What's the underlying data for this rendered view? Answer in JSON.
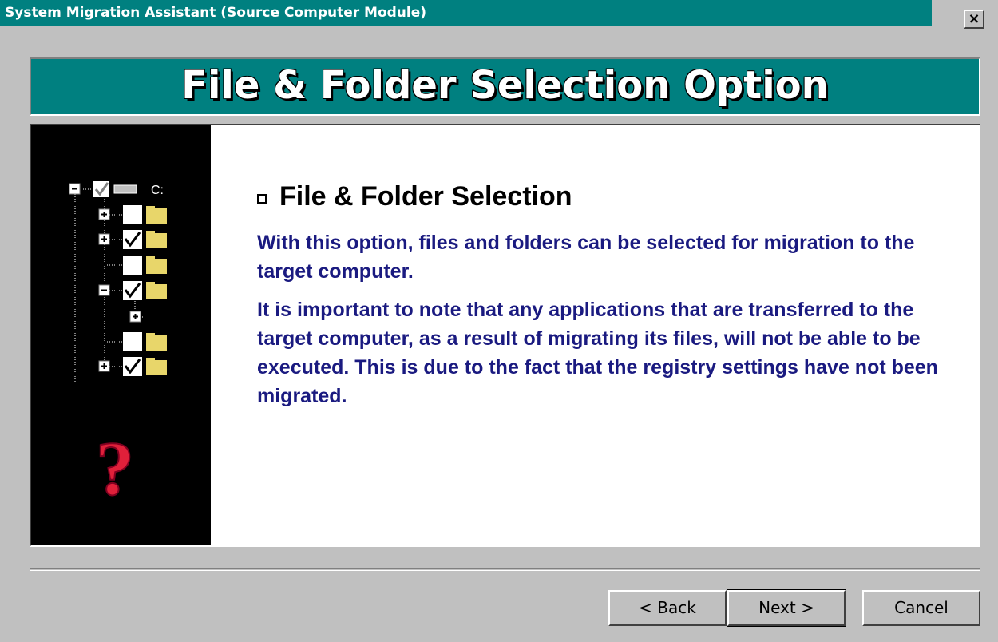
{
  "window": {
    "title": "System Migration Assistant (Source Computer Module)",
    "close_label": "×"
  },
  "banner": {
    "title": "File & Folder Selection Option"
  },
  "content": {
    "heading": "File & Folder Selection",
    "paragraphs": [
      "With this option, files and folders can be selected for migration to the target computer.",
      "It is important to note that any applications that are transferred to the target computer, as a result of migrating its files, will not be able to be executed.  This is due to the fact that the registry settings have not been migrated."
    ]
  },
  "illustration": {
    "drive_label": "C:",
    "question_mark": "?"
  },
  "buttons": {
    "back": "< Back",
    "next": "Next >",
    "cancel": "Cancel"
  }
}
